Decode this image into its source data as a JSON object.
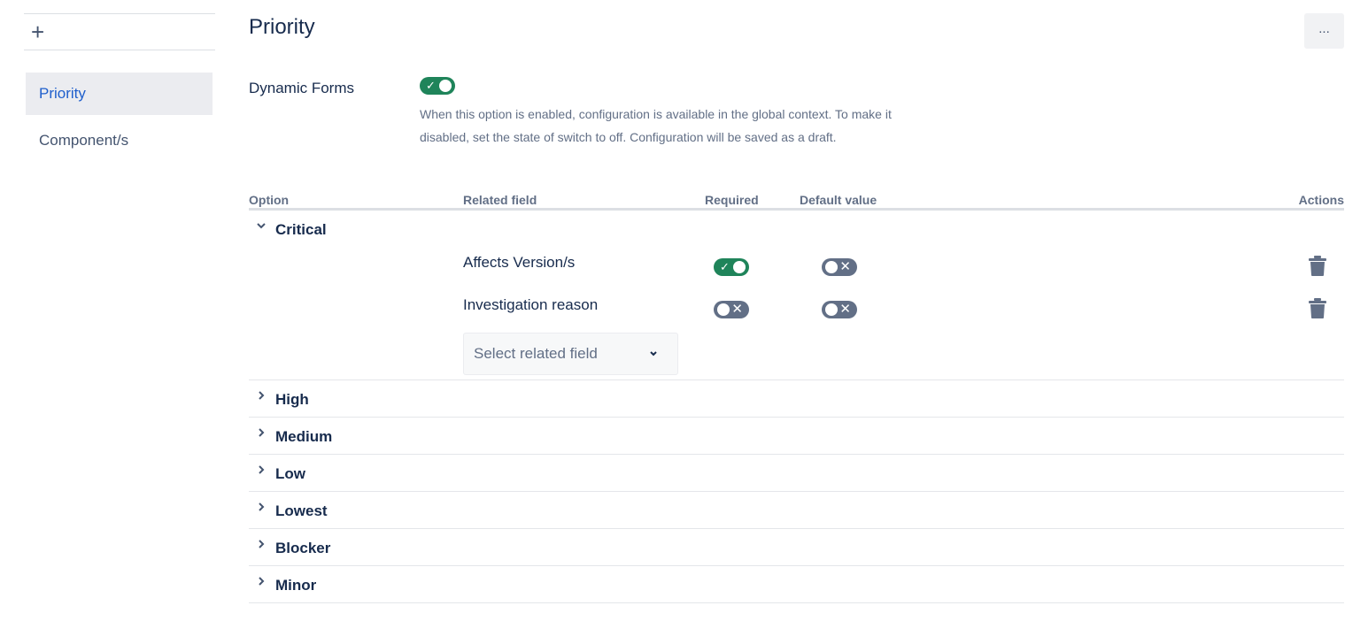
{
  "sidebar": {
    "add_label": "+",
    "items": [
      {
        "label": "Priority",
        "active": true
      },
      {
        "label": "Component/s",
        "active": false
      }
    ]
  },
  "header": {
    "title": "Priority",
    "more_label": "..."
  },
  "dynamic_forms": {
    "label": "Dynamic Forms",
    "enabled": true,
    "description": "When this option is enabled, configuration is available in the global context. To make it disabled, set the state of switch to off. Configuration will be saved as a draft."
  },
  "table": {
    "columns": {
      "option": "Option",
      "related_field": "Related field",
      "required": "Required",
      "default_value": "Default value",
      "actions": "Actions"
    },
    "groups": [
      {
        "name": "Critical",
        "expanded": true,
        "fields": [
          {
            "name": "Affects Version/s",
            "required": true,
            "default_value": false
          },
          {
            "name": "Investigation reason",
            "required": false,
            "default_value": false
          }
        ],
        "select_placeholder": "Select related field"
      },
      {
        "name": "High",
        "expanded": false
      },
      {
        "name": "Medium",
        "expanded": false
      },
      {
        "name": "Low",
        "expanded": false
      },
      {
        "name": "Lowest",
        "expanded": false
      },
      {
        "name": "Blocker",
        "expanded": false
      },
      {
        "name": "Minor",
        "expanded": false
      }
    ]
  },
  "colors": {
    "toggle_on": "#1f845a",
    "toggle_off": "#626f86",
    "active_nav": "#1f5fcc"
  },
  "icons": {
    "add": "plus-icon",
    "expanded": "chevron-down-icon",
    "collapsed": "chevron-right-icon",
    "delete": "trash-icon",
    "dropdown": "chevron-down-icon"
  }
}
